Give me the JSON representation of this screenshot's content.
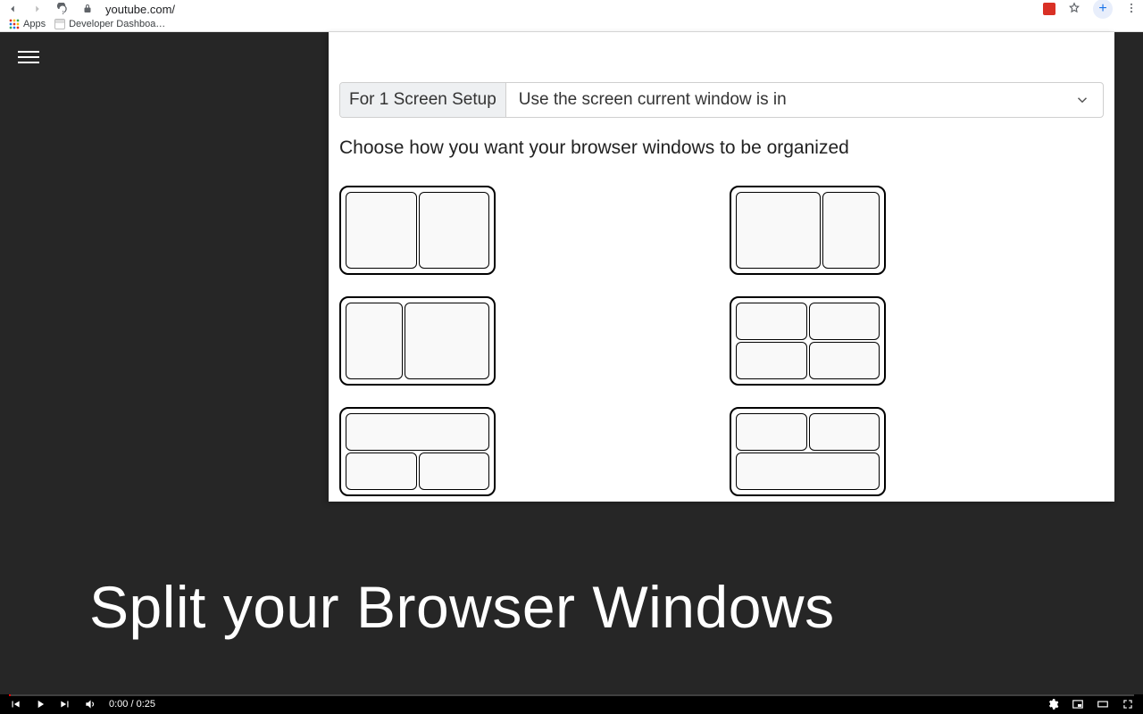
{
  "browser": {
    "url_host": "youtube.com/",
    "bookmarks": {
      "apps": "Apps",
      "dev_dashboard": "Developer Dashboa…"
    }
  },
  "popup": {
    "setup_label": "For 1 Screen Setup",
    "setup_select_value": "Use the screen current window is in",
    "choose_text": "Choose how you want your browser windows to be organized"
  },
  "headline": "Split your Browser Windows",
  "player": {
    "time_current": "0:00",
    "time_sep": " / ",
    "time_total": "0:25"
  }
}
